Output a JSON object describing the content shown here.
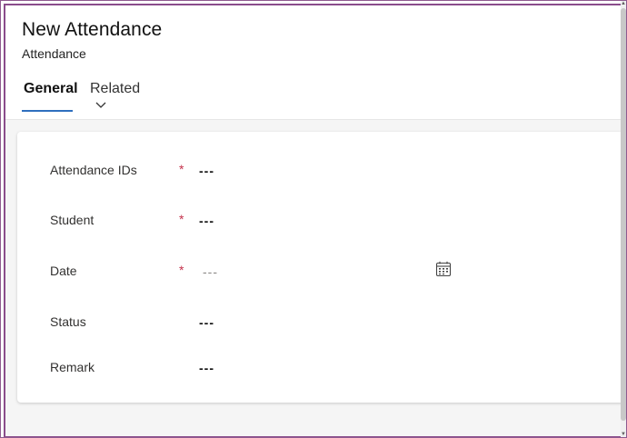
{
  "header": {
    "title": "New Attendance",
    "subtitle": "Attendance"
  },
  "tabs": [
    {
      "label": "General",
      "selected": true
    },
    {
      "label": "Related",
      "selected": false
    }
  ],
  "form": {
    "fields": [
      {
        "label": "Attendance IDs",
        "required": true,
        "value": "---"
      },
      {
        "label": "Student",
        "required": true,
        "value": "---"
      },
      {
        "label": "Date",
        "required": true,
        "value": "---",
        "placeholder": true,
        "icon": "calendar-icon"
      },
      {
        "label": "Status",
        "required": false,
        "value": "---"
      },
      {
        "label": "Remark",
        "required": false,
        "value": "---"
      }
    ],
    "required_marker": "*"
  },
  "colors": {
    "accent": "#2f6fbe",
    "required": "#c4314b",
    "frame": "#8a4d8b"
  }
}
